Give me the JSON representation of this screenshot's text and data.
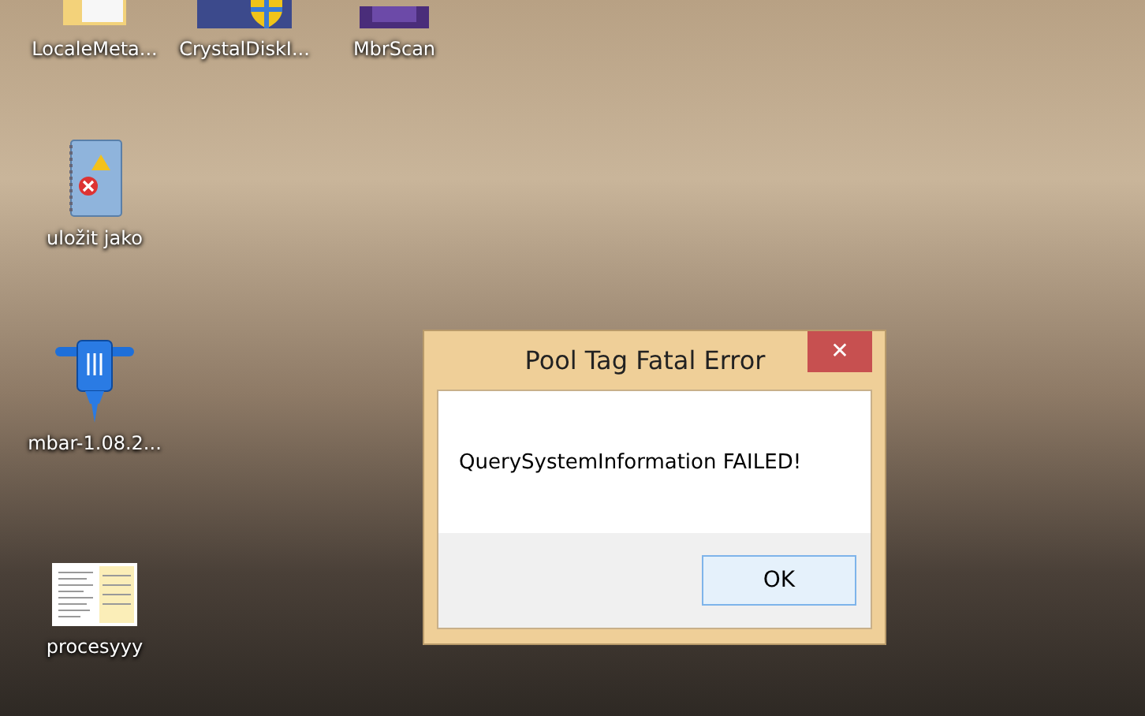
{
  "desktop_icons": [
    {
      "label": "LocaleMeta...",
      "kind": "folder"
    },
    {
      "label": "CrystalDiskI...",
      "kind": "shield-app"
    },
    {
      "label": "MbrScan",
      "kind": "purple-app"
    },
    {
      "label": "uložit jako",
      "kind": "notebook"
    },
    {
      "label": "mbar-1.08.2...",
      "kind": "jackhammer"
    },
    {
      "label": "procesyyy",
      "kind": "sheet"
    }
  ],
  "dialog": {
    "title": "Pool Tag Fatal Error",
    "close": "✕",
    "message": "QuerySystemInformation FAILED!",
    "buttons": [
      "OK"
    ]
  }
}
